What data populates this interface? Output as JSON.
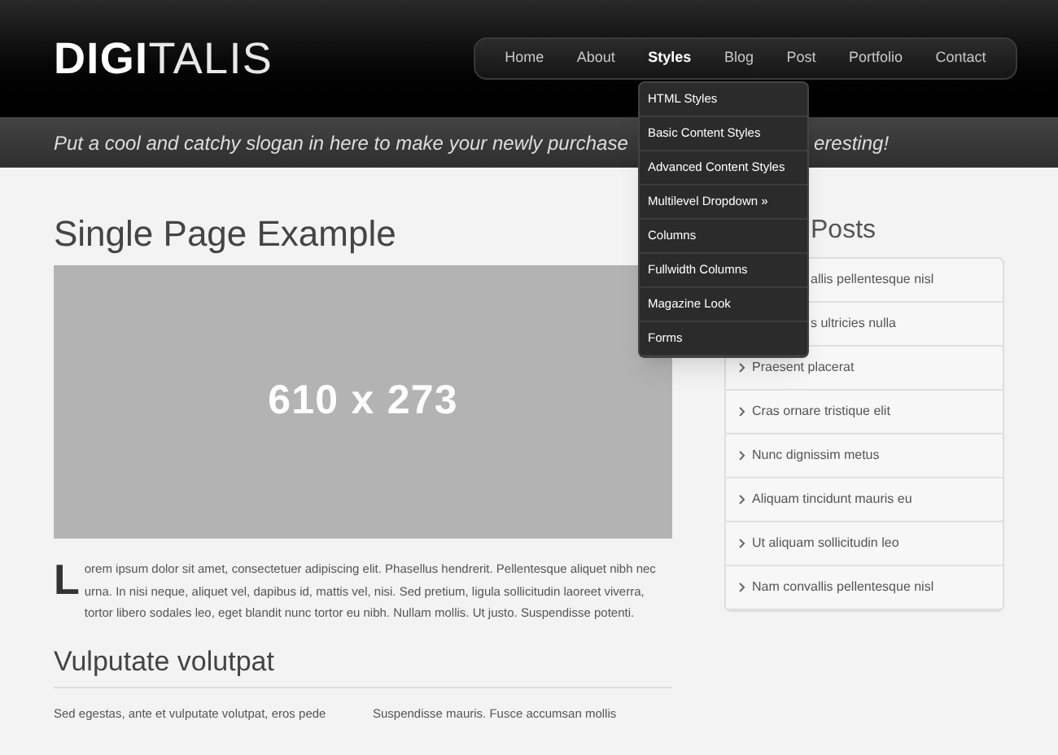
{
  "logo": {
    "bold": "DIGI",
    "light": "TALIS"
  },
  "nav": [
    {
      "label": "Home",
      "selected": false
    },
    {
      "label": "About",
      "selected": false
    },
    {
      "label": "Styles",
      "selected": true
    },
    {
      "label": "Blog",
      "selected": false
    },
    {
      "label": "Post",
      "selected": false
    },
    {
      "label": "Portfolio",
      "selected": false
    },
    {
      "label": "Contact",
      "selected": false
    }
  ],
  "dropdown": [
    "HTML Styles",
    "Basic Content Styles",
    "Advanced Content Styles",
    "Multilevel Dropdown »",
    "Columns",
    "Fullwidth Columns",
    "Magazine Look",
    "Forms"
  ],
  "slogan": [
    "Put a cool and catchy slogan in here to make your newly purchase",
    "eresting!"
  ],
  "main": {
    "title": "Single Page Example",
    "image_label": "610 x 273",
    "drop_cap": "L",
    "paragraph": "orem ipsum dolor sit amet, consectetuer adipiscing elit. Phasellus hendrerit. Pellentesque aliquet nibh nec urna. In nisi neque, aliquet vel, dapibus id, mattis vel, nisi. Sed pretium, ligula sollicitudin laoreet viverra, tortor libero sodales leo, eget blandit nunc tortor eu nibh. Nullam mollis. Ut justo. Suspendisse potenti.",
    "subheading": "Vulputate volutpat",
    "columns": [
      "Sed egestas, ante et vulputate volutpat, eros pede",
      "Suspendisse mauris. Fusce accumsan mollis"
    ]
  },
  "sidebar": {
    "heading": "Posts",
    "items": [
      {
        "kind": "covered",
        "text": "allis pellentesque nisl"
      },
      {
        "kind": "covered",
        "text": "s ultricies nulla"
      },
      {
        "kind": "link",
        "text": "Praesent placerat"
      },
      {
        "kind": "link",
        "text": "Cras ornare tristique elit"
      },
      {
        "kind": "link",
        "text": "Nunc dignissim metus"
      },
      {
        "kind": "link",
        "text": "Aliquam tincidunt mauris eu"
      },
      {
        "kind": "link",
        "text": "Ut aliquam sollicitudin leo"
      },
      {
        "kind": "link",
        "text": "Nam convallis pellentesque nisl"
      }
    ]
  }
}
